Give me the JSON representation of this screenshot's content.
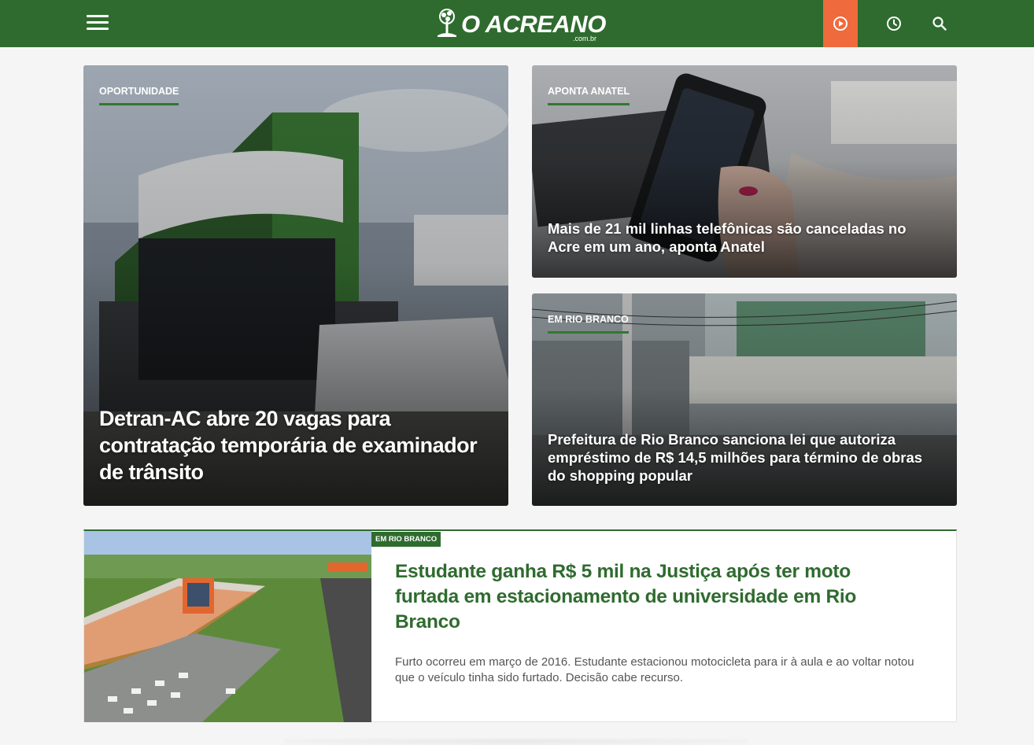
{
  "header": {
    "logo_text": "O ACREANO",
    "logo_sub": ".com.br",
    "menu_icon": "hamburger-menu-icon",
    "play_icon": "play-circle-icon",
    "clock_icon": "clock-icon",
    "search_icon": "search-icon",
    "brand_color": "#2f6b2f",
    "accent_color": "#ef6a3c"
  },
  "cards": [
    {
      "kicker": "OPORTUNIDADE",
      "headline": "Detran-AC abre 20 vagas para contratação temporária de examinador de trânsito"
    },
    {
      "kicker": "APONTA ANATEL",
      "headline": "Mais de 21 mil linhas telefônicas são canceladas no Acre em um ano, aponta Anatel"
    },
    {
      "kicker": "EM RIO BRANCO",
      "headline": "Prefeitura de Rio Branco sanciona lei que autoriza empréstimo de R$ 14,5 milhões para término de obras do shopping popular"
    }
  ],
  "feature": {
    "badge": "EM RIO BRANCO",
    "title": "Estudante ganha R$ 5 mil na Justiça após ter moto furtada em estacionamento de universidade em Rio Branco",
    "description": "Furto ocorreu em março de 2016. Estudante estacionou motocicleta para ir à aula e ao voltar notou que o veículo tinha sido furtado. Decisão cabe recurso."
  }
}
